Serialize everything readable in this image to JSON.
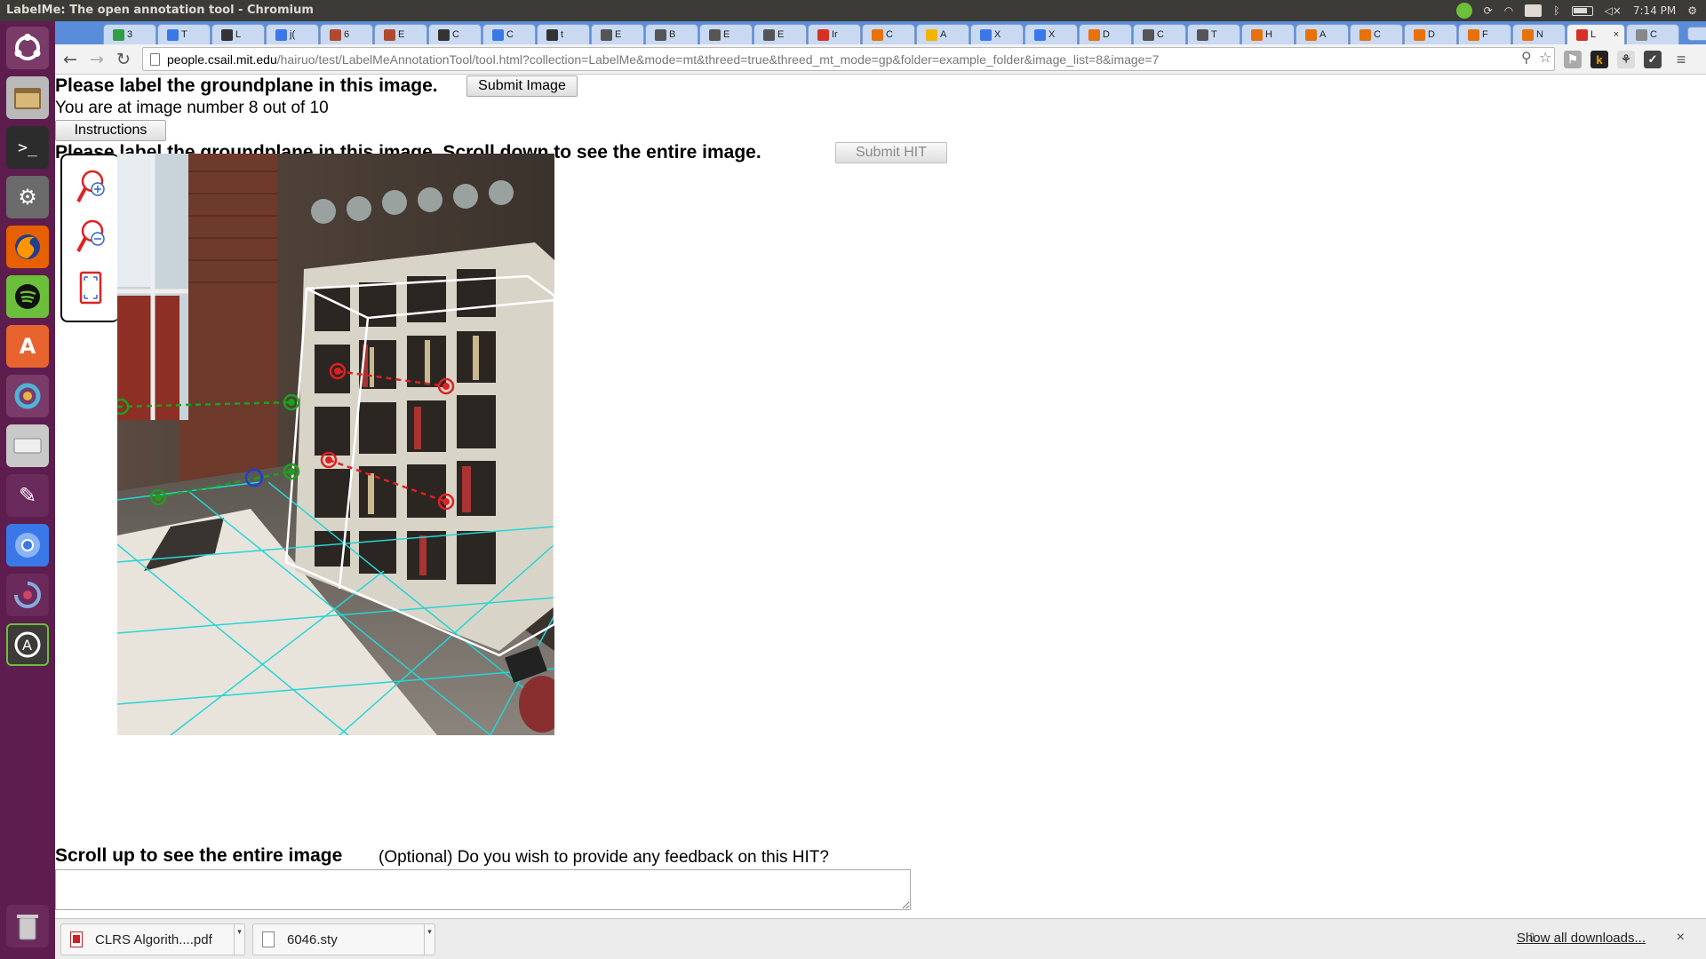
{
  "window": {
    "title": "LabelMe: The open annotation tool - Chromium",
    "clock": "7:14 PM",
    "keyboard": "En"
  },
  "tabs": [
    {
      "label": "3",
      "color": "#2f9e44"
    },
    {
      "label": "T",
      "color": "#3b78e7"
    },
    {
      "label": "L",
      "color": "#333333"
    },
    {
      "label": "j(",
      "color": "#3b78e7"
    },
    {
      "label": "6",
      "color": "#b04a2f"
    },
    {
      "label": "E",
      "color": "#b04a2f"
    },
    {
      "label": "C",
      "color": "#333333"
    },
    {
      "label": "C",
      "color": "#3b78e7"
    },
    {
      "label": "t",
      "color": "#333333"
    },
    {
      "label": "E",
      "color": "#555555"
    },
    {
      "label": "B",
      "color": "#555555"
    },
    {
      "label": "E",
      "color": "#555555"
    },
    {
      "label": "E",
      "color": "#555555"
    },
    {
      "label": "Ir",
      "color": "#d93025"
    },
    {
      "label": "C",
      "color": "#e8710a"
    },
    {
      "label": "A",
      "color": "#f4b400"
    },
    {
      "label": "X",
      "color": "#3b78e7"
    },
    {
      "label": "X",
      "color": "#3b78e7"
    },
    {
      "label": "D",
      "color": "#e8710a"
    },
    {
      "label": "C",
      "color": "#555555"
    },
    {
      "label": "T",
      "color": "#555555"
    },
    {
      "label": "H",
      "color": "#e8710a"
    },
    {
      "label": "A",
      "color": "#e8710a"
    },
    {
      "label": "C",
      "color": "#e8710a"
    },
    {
      "label": "D",
      "color": "#e8710a"
    },
    {
      "label": "F",
      "color": "#e8710a"
    },
    {
      "label": "N",
      "color": "#e8710a"
    },
    {
      "label": "L",
      "color": "#d93025",
      "active": true
    },
    {
      "label": "C",
      "color": "#888888"
    }
  ],
  "omnibox": {
    "host": "people.csail.mit.edu",
    "path": "/hairuo/test/LabelMeAnnotationTool/tool.html?collection=LabelMe&mode=mt&threed=true&threed_mt_mode=gp&folder=example_folder&image_list=8&image=7"
  },
  "page": {
    "heading1": "Please label the groundplane in this image.",
    "submit_image": "Submit Image",
    "progress": "You are at image number 8 out of 10",
    "instructions": "Instructions",
    "heading2": "Please label the groundplane in this image. Scroll down to see the entire image.",
    "submit_hit": "Submit HIT",
    "scroll_up": "Scroll up to see the entire image",
    "feedback_prompt": "(Optional) Do you wish to provide any feedback on this HIT?",
    "feedback_value": ""
  },
  "downloads": {
    "items": [
      {
        "name": "CLRS Algorith....pdf",
        "type": "pdf"
      },
      {
        "name": "6046.sty",
        "type": "file"
      }
    ],
    "show_all": "Show all downloads...",
    "close": "×"
  },
  "icons": {
    "zoom_in": "zoom-in-icon",
    "zoom_out": "zoom-out-icon",
    "fit": "fit-screen-icon"
  }
}
